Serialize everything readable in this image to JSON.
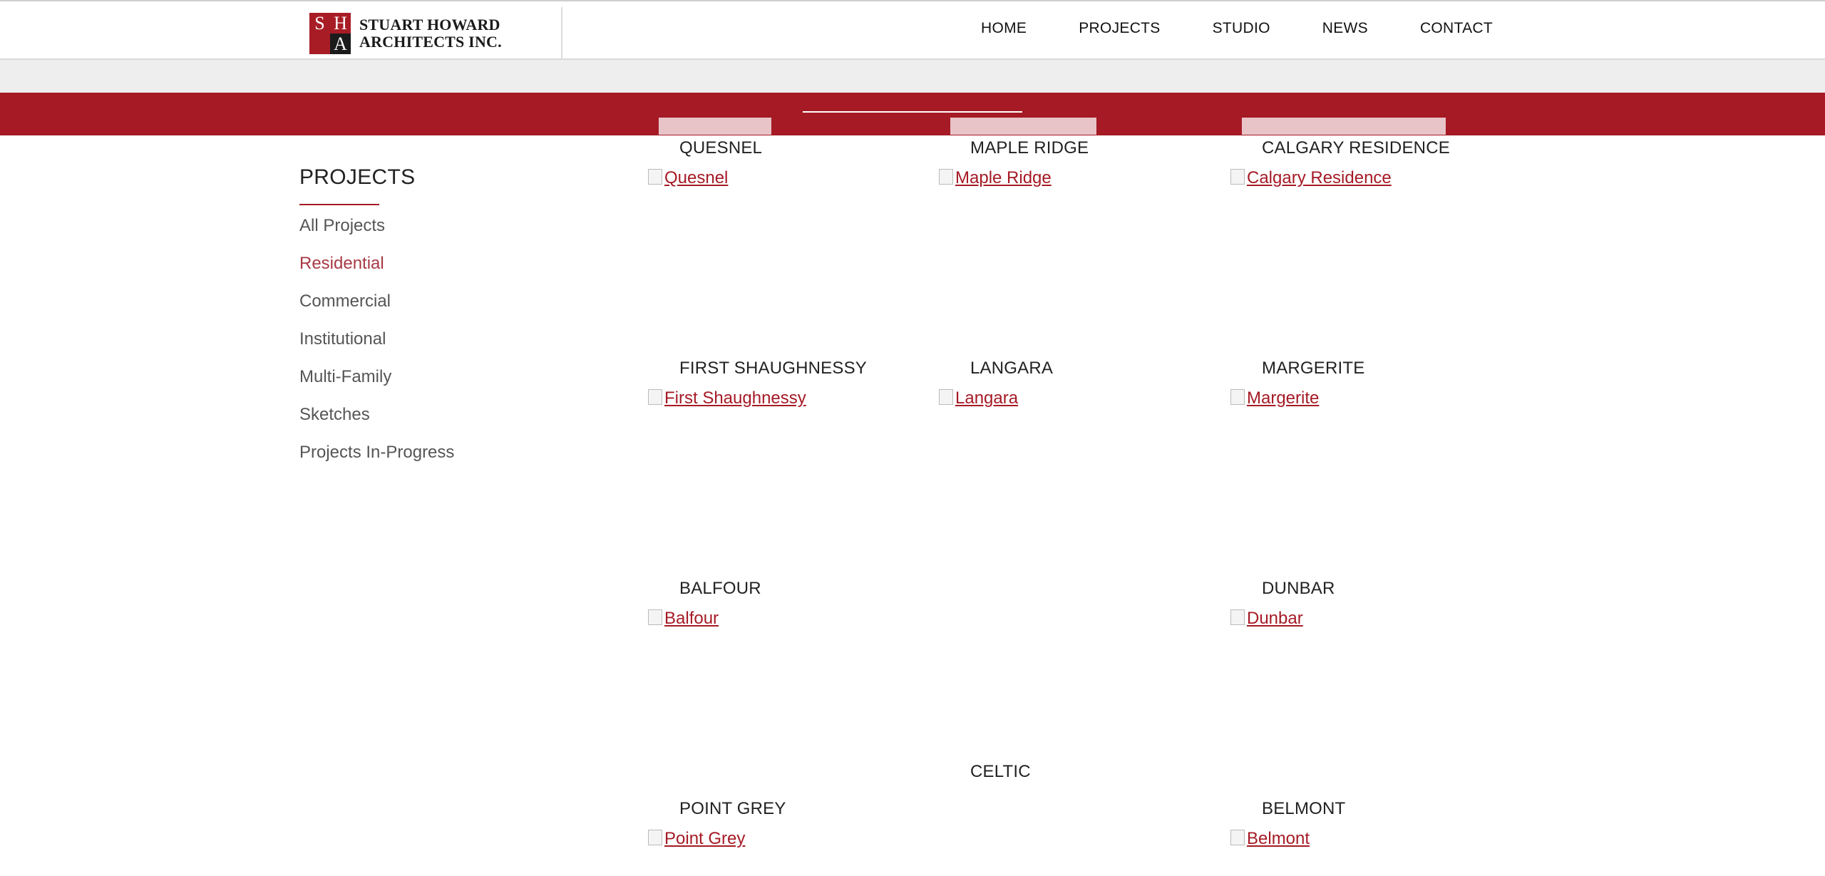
{
  "header": {
    "logo": {
      "letters": [
        "S",
        "H",
        "",
        "A"
      ],
      "line1": "STUART HOWARD",
      "line2": "ARCHITECTS INC."
    },
    "nav": [
      "HOME",
      "PROJECTS",
      "STUDIO",
      "NEWS",
      "CONTACT"
    ]
  },
  "sidebar": {
    "title": "PROJECTS",
    "items": [
      {
        "label": "All Projects",
        "active": false
      },
      {
        "label": "Residential",
        "active": true
      },
      {
        "label": "Commercial",
        "active": false
      },
      {
        "label": "Institutional",
        "active": false
      },
      {
        "label": "Multi-Family",
        "active": false
      },
      {
        "label": "Sketches",
        "active": false
      },
      {
        "label": "Projects In-Progress",
        "active": false
      }
    ]
  },
  "projects": [
    {
      "title": "QUESNEL",
      "alt": "Quesnel"
    },
    {
      "title": "MAPLE RIDGE",
      "alt": "Maple Ridge"
    },
    {
      "title": "CALGARY RESIDENCE",
      "alt": "Calgary Residence"
    },
    {
      "title": "FIRST SHAUGHNESSY",
      "alt": "First Shaughnessy"
    },
    {
      "title": "LANGARA",
      "alt": "Langara"
    },
    {
      "title": "MARGERITE",
      "alt": "Margerite"
    },
    {
      "title": "BALFOUR",
      "alt": "Balfour"
    },
    {
      "title": "CELTIC",
      "alt": ""
    },
    {
      "title": "DUNBAR",
      "alt": "Dunbar"
    },
    {
      "title": "POINT GREY",
      "alt": "Point Grey"
    },
    {
      "title": "BELMONT",
      "alt": "Belmont"
    }
  ],
  "colors": {
    "brand_red": "#a51a25",
    "active_link": "#a83a44",
    "grey_band": "#eeeeee"
  }
}
